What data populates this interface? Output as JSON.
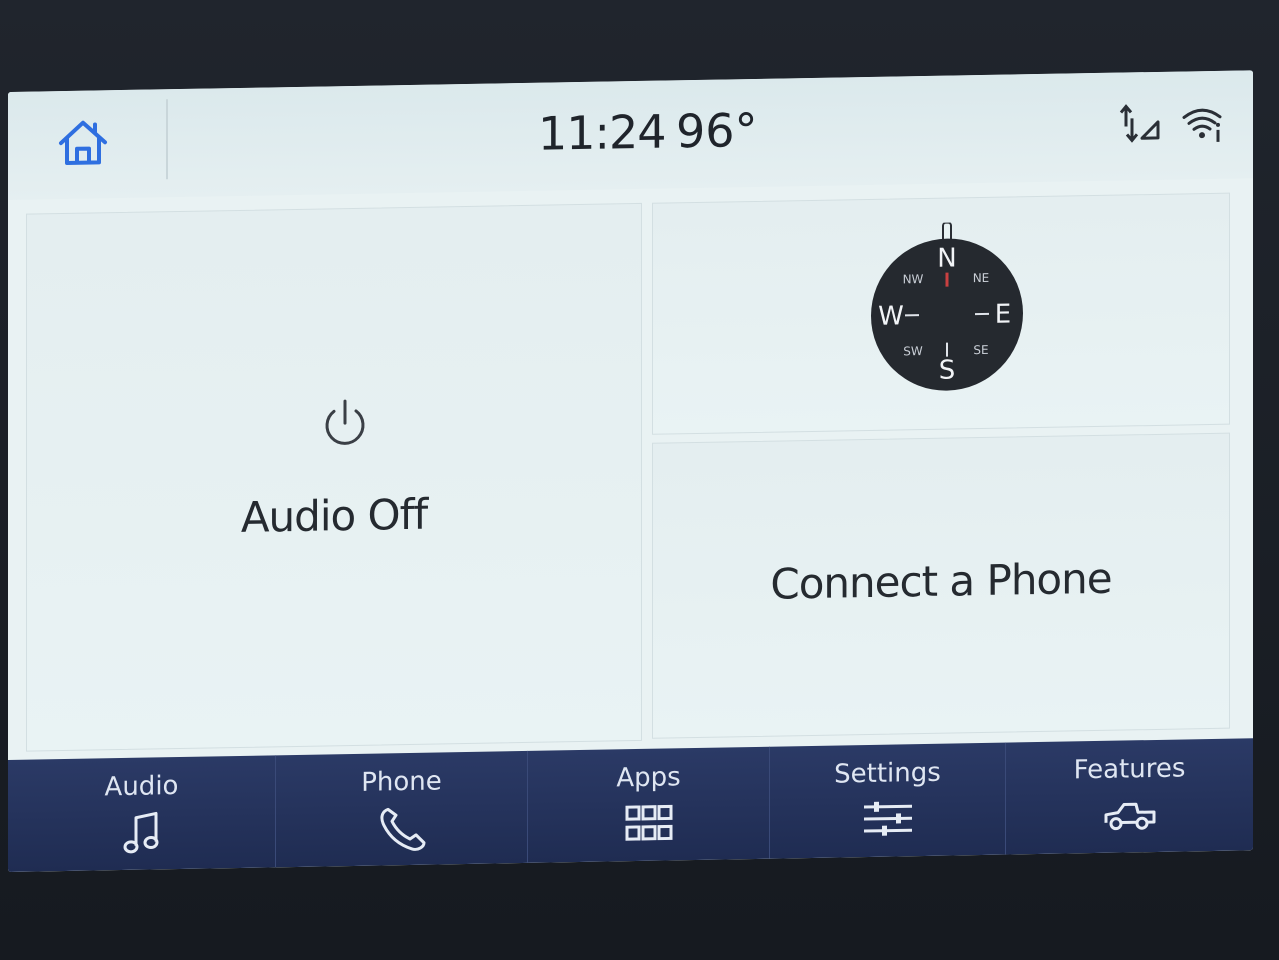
{
  "status": {
    "time": "11:24",
    "temperature": "96°",
    "icons": [
      "home-icon",
      "signal-icon",
      "wifi-icon"
    ]
  },
  "tiles": {
    "audio": {
      "label": "Audio Off",
      "icon": "power-icon"
    },
    "compass": {
      "icon": "compass-icon",
      "directions": {
        "n": "N",
        "e": "E",
        "s": "S",
        "w": "W",
        "ne": "NE",
        "nw": "NW",
        "se": "SE",
        "sw": "SW"
      }
    },
    "phone": {
      "label": "Connect a Phone"
    }
  },
  "nav": {
    "items": [
      {
        "label": "Audio",
        "icon": "music-note-icon"
      },
      {
        "label": "Phone",
        "icon": "phone-icon"
      },
      {
        "label": "Apps",
        "icon": "grid-icon"
      },
      {
        "label": "Settings",
        "icon": "sliders-icon"
      },
      {
        "label": "Features",
        "icon": "truck-icon"
      }
    ]
  },
  "colors": {
    "accent": "#2f6fe0",
    "nav_bg": "#24335c",
    "screen_bg": "#e9f2f3",
    "text": "#252a30"
  }
}
